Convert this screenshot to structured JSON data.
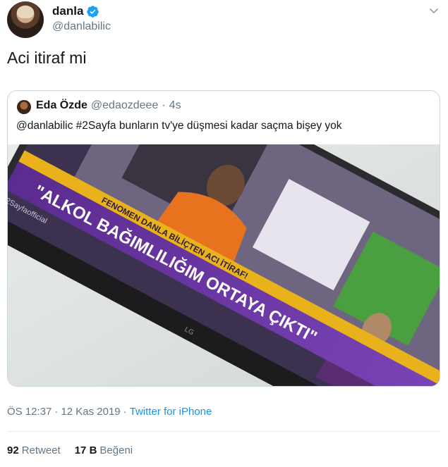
{
  "author": {
    "name": "danla",
    "handle": "@danlabilic",
    "verified": true
  },
  "tweet": {
    "text": "Aci itiraf mi"
  },
  "quoted_tweet": {
    "name": "Eda Özde",
    "handle": "@edaozdeee",
    "separator": "·",
    "time": "4s",
    "text": "@danlabilic #2Sayfa bunların tv'ye düşmesi kadar saçma bişey yok",
    "photo": {
      "banner_top": "FENOMEN DANLA BİLİÇTEN ACI İTİRAF!",
      "banner_main": "\"ALKOL BAĞIMLILIĞIM ORTAYA ÇIKTI\"",
      "channel_handle": "2Sayfaofficial",
      "tv_brand": "LG"
    }
  },
  "meta": {
    "time": "ÖS 12:37",
    "separator": "·",
    "date": "12 Kas 2019",
    "separator2": "·",
    "source": "Twitter for iPhone"
  },
  "stats": {
    "retweets_count": "92",
    "retweets_label": "Retweet",
    "likes_count": "17 B",
    "likes_label": "Beğeni"
  },
  "colors": {
    "link": "#1b95e0",
    "verified": "#1da1f2",
    "muted": "#657786",
    "border": "#ccd6dd"
  },
  "icons": [
    "verified-badge-icon",
    "chevron-down-icon"
  ]
}
